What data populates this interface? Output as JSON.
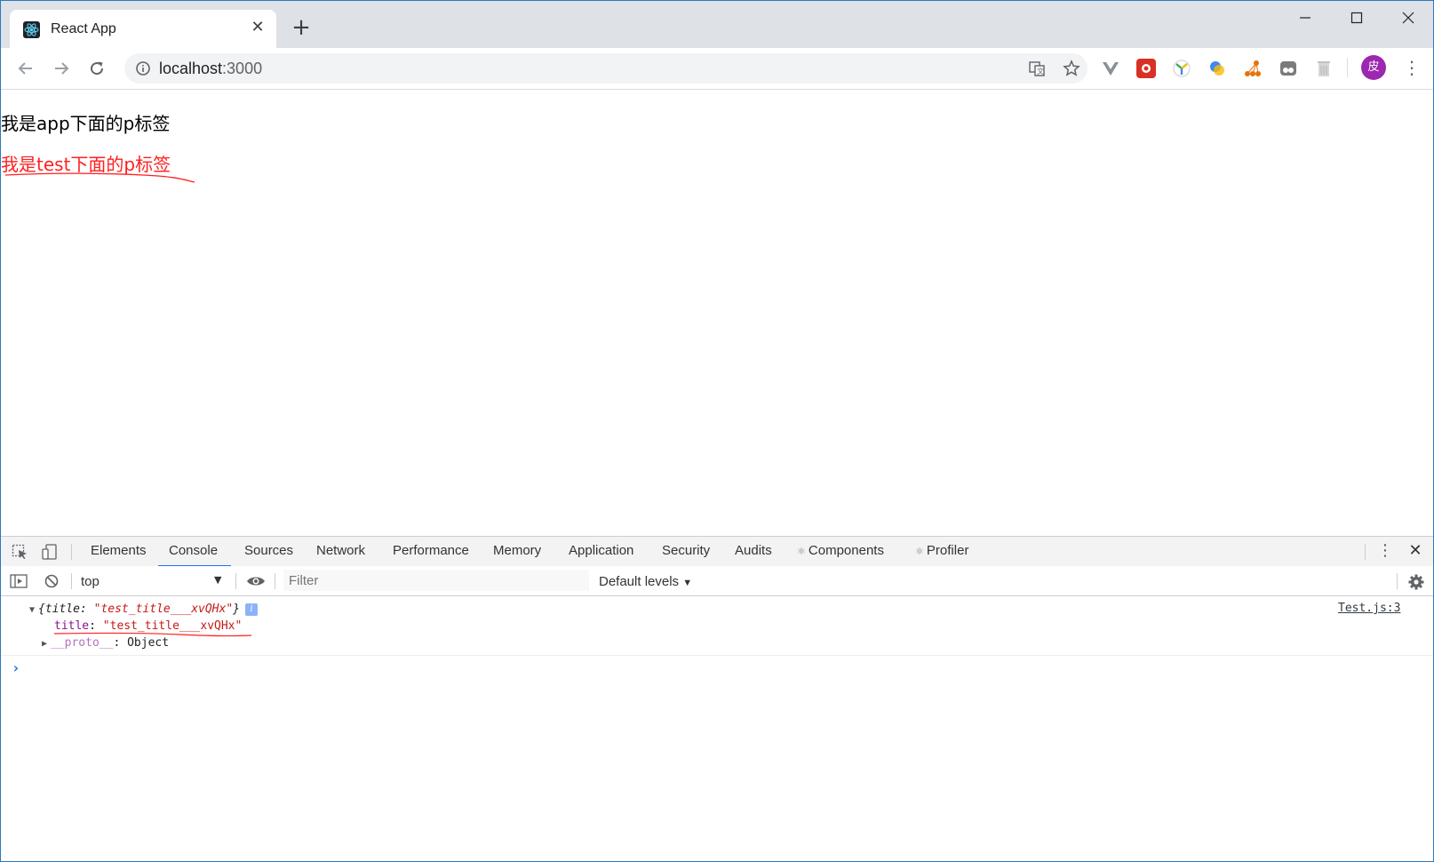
{
  "browser": {
    "tab_title": "React App",
    "url_host": "localhost",
    "url_port": ":3000",
    "avatar_letter": "皮"
  },
  "page": {
    "app_paragraph": "我是app下面的p标签",
    "test_paragraph": "我是test下面的p标签",
    "test_color": "#ff1f1f"
  },
  "devtools": {
    "tabs": [
      {
        "label": "Elements"
      },
      {
        "label": "Console"
      },
      {
        "label": "Sources"
      },
      {
        "label": "Network"
      },
      {
        "label": "Performance"
      },
      {
        "label": "Memory"
      },
      {
        "label": "Application"
      },
      {
        "label": "Security"
      },
      {
        "label": "Audits"
      },
      {
        "label": "Components",
        "icon": "react-atom-icon"
      },
      {
        "label": "Profiler",
        "icon": "react-atom-icon"
      }
    ],
    "active_tab": "Console",
    "context": "top",
    "filter_placeholder": "Filter",
    "levels": "Default levels",
    "log": {
      "summary_open": "{",
      "summary_key": "title",
      "summary_sep": ": ",
      "summary_value": "\"test_title___xvQHx\"",
      "summary_close": "}",
      "info_badge": "i",
      "prop_key": "title",
      "prop_sep": ": ",
      "prop_value": "\"test_title___xvQHx\"",
      "proto_key": "__proto__",
      "proto_sep": ": ",
      "proto_value": "Object",
      "source": "Test.js:3"
    },
    "prompt_symbol": "›",
    "accent_color": "#1a73e8"
  }
}
